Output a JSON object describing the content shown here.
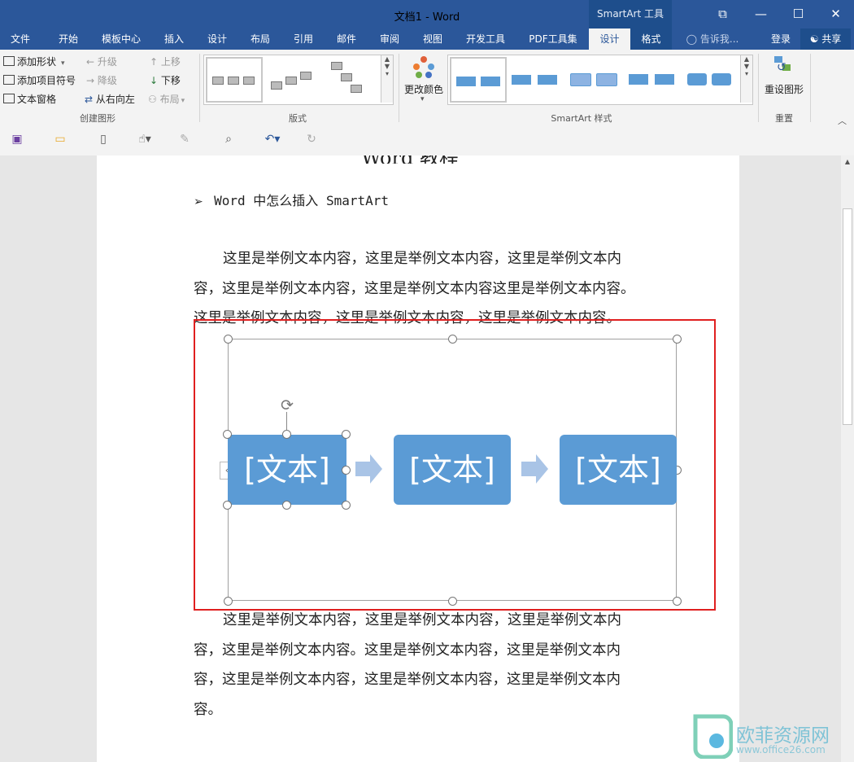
{
  "window": {
    "title": "文档1 - Word",
    "context_tab_group": "SmartArt 工具",
    "controls": {
      "restore": "⧉",
      "minimize": "—",
      "maximize": "☐",
      "close": "✕"
    }
  },
  "tabs": [
    {
      "label": "文件"
    },
    {
      "label": "开始"
    },
    {
      "label": "模板中心"
    },
    {
      "label": "插入"
    },
    {
      "label": "设计"
    },
    {
      "label": "布局"
    },
    {
      "label": "引用"
    },
    {
      "label": "邮件"
    },
    {
      "label": "审阅"
    },
    {
      "label": "视图"
    },
    {
      "label": "开发工具"
    },
    {
      "label": "PDF工具集"
    },
    {
      "label": "设计"
    },
    {
      "label": "格式"
    }
  ],
  "tell_me": "告诉我...",
  "login": "登录",
  "share": "共享",
  "ribbon": {
    "create_graphic": {
      "add_shape": "添加形状",
      "add_bullet": "添加项目符号",
      "text_pane": "文本窗格",
      "promote": "升级",
      "demote": "降级",
      "right_to_left": "从右向左",
      "move_up": "上移",
      "move_down": "下移",
      "layout": "布局",
      "group_label": "创建图形"
    },
    "layouts": {
      "group_label": "版式"
    },
    "change_colors": "更改颜色",
    "styles": {
      "group_label": "SmartArt 样式"
    },
    "reset": {
      "button": "重设图形",
      "group_label": "重置"
    }
  },
  "document": {
    "heading_partial": "Word 教程",
    "bullet": "Word 中怎么插入 SmartArt",
    "para1": [
      "这里是举例文本内容，这里是举例文本内容，这里是举例文本内",
      "容，这里是举例文本内容，这里是举例文本内容这里是举例文本内容。",
      "这里是举例文本内容，这里是举例文本内容，这里是举例文本内容。"
    ],
    "smartart": {
      "shapes": [
        "[文本]",
        "[文本]",
        "[文本]"
      ]
    },
    "para2": [
      "这里是举例文本内容，这里是举例文本内容，这里是举例文本内",
      "容，这里是举例文本内容。这里是举例文本内容，这里是举例文本内",
      "容，这里是举例文本内容，这里是举例文本内容，这里是举例文本内",
      "容。"
    ]
  },
  "watermark": {
    "brand": "欧菲资源网",
    "url": "www.office26.com"
  },
  "colors": {
    "title_bar": "#2b579a",
    "smartart_fill": "#5b9bd5",
    "arrow": "#a9c4e6",
    "selection_border": "#e02020"
  }
}
